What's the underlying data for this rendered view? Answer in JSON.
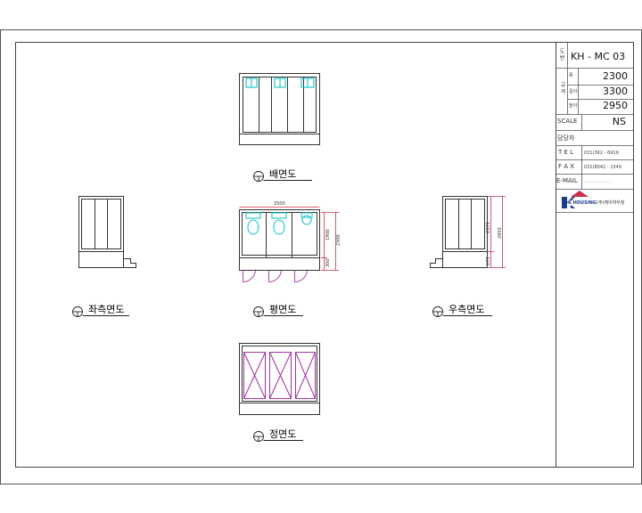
{
  "title_block": {
    "code_label": "도 번",
    "code": "KH - MC 03",
    "size_label": "규 격",
    "width_label": "폭",
    "width": "2300",
    "length_label": "길이",
    "length": "3300",
    "height_label": "높이",
    "height": "2950",
    "scale_label": "SCALE",
    "scale": "NS",
    "manager_label": "담당자",
    "tel_label": "T E L",
    "tel": "031)362 - 6919",
    "fax_label": "F A X",
    "fax": "031)8042 - 2349",
    "email_label": "E-MAIL",
    "email": "·· ·· ····· ·· ··· ·· ··",
    "logo_text": "K HOUSING",
    "company": "(주)케이하우징"
  },
  "views": {
    "rear": "배면도",
    "left": "좌측면도",
    "plan": "평면도",
    "right": "우측면도",
    "front": "정면도"
  },
  "dimensions": {
    "plan_width": "3300",
    "plan_depth_inner": "1900",
    "plan_depth_total": "2300",
    "plan_step": "300",
    "side_height_1": "2375",
    "side_height_2": "2950",
    "side_step": "275"
  },
  "colors": {
    "line": "#333333",
    "fixture": "#1fc7c7",
    "door": "#a033a0",
    "dim": "#c8304a"
  }
}
